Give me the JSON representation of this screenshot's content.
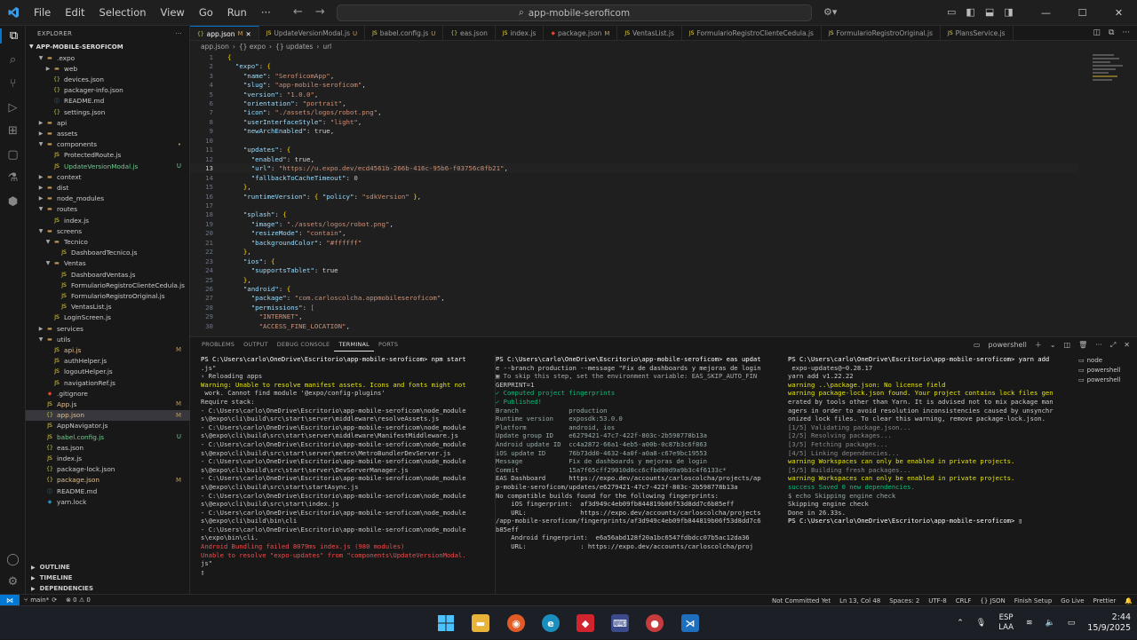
{
  "window": {
    "menu": [
      "File",
      "Edit",
      "Selection",
      "View",
      "Go",
      "Run",
      "···"
    ],
    "search": "app-mobile-seroficom"
  },
  "sidebar": {
    "header": "EXPLORER",
    "project": "APP-MOBILE-SEROFICOM",
    "tree": [
      {
        "label": ".expo",
        "depth": 1,
        "type": "folder-open",
        "badge": ""
      },
      {
        "label": "web",
        "depth": 2,
        "type": "folder",
        "badge": ""
      },
      {
        "label": "devices.json",
        "depth": 2,
        "type": "file",
        "badge": ""
      },
      {
        "label": "packager-info.json",
        "depth": 2,
        "type": "file",
        "badge": ""
      },
      {
        "label": "README.md",
        "depth": 2,
        "type": "file",
        "badge": ""
      },
      {
        "label": "settings.json",
        "depth": 2,
        "type": "file",
        "badge": ""
      },
      {
        "label": "api",
        "depth": 1,
        "type": "folder",
        "badge": ""
      },
      {
        "label": "assets",
        "depth": 1,
        "type": "folder",
        "badge": ""
      },
      {
        "label": "components",
        "depth": 1,
        "type": "folder-open",
        "badge": "•"
      },
      {
        "label": "ProtectedRoute.js",
        "depth": 2,
        "type": "file",
        "badge": ""
      },
      {
        "label": "UpdateVersionModal.js",
        "depth": 2,
        "type": "file",
        "badge": "U"
      },
      {
        "label": "context",
        "depth": 1,
        "type": "folder",
        "badge": ""
      },
      {
        "label": "dist",
        "depth": 1,
        "type": "folder",
        "badge": ""
      },
      {
        "label": "node_modules",
        "depth": 1,
        "type": "folder",
        "badge": ""
      },
      {
        "label": "routes",
        "depth": 1,
        "type": "folder-open",
        "badge": ""
      },
      {
        "label": "index.js",
        "depth": 2,
        "type": "file",
        "badge": ""
      },
      {
        "label": "screens",
        "depth": 1,
        "type": "folder-open",
        "badge": ""
      },
      {
        "label": "Tecnico",
        "depth": 2,
        "type": "folder-open",
        "badge": ""
      },
      {
        "label": "DashboardTecnico.js",
        "depth": 3,
        "type": "file",
        "badge": ""
      },
      {
        "label": "Ventas",
        "depth": 2,
        "type": "folder-open",
        "badge": ""
      },
      {
        "label": "DashboardVentas.js",
        "depth": 3,
        "type": "file",
        "badge": ""
      },
      {
        "label": "FormularioRegistroClienteCedula.js",
        "depth": 3,
        "type": "file",
        "badge": ""
      },
      {
        "label": "FormularioRegistroOriginal.js",
        "depth": 3,
        "type": "file",
        "badge": ""
      },
      {
        "label": "VentasList.js",
        "depth": 3,
        "type": "file",
        "badge": ""
      },
      {
        "label": "LoginScreen.js",
        "depth": 2,
        "type": "file",
        "badge": ""
      },
      {
        "label": "services",
        "depth": 1,
        "type": "folder",
        "badge": ""
      },
      {
        "label": "utils",
        "depth": 1,
        "type": "folder-open",
        "badge": ""
      },
      {
        "label": "api.js",
        "depth": 2,
        "type": "file",
        "badge": "M"
      },
      {
        "label": "authHelper.js",
        "depth": 2,
        "type": "file",
        "badge": ""
      },
      {
        "label": "logoutHelper.js",
        "depth": 2,
        "type": "file",
        "badge": ""
      },
      {
        "label": "navigationRef.js",
        "depth": 2,
        "type": "file",
        "badge": ""
      },
      {
        "label": ".gitignore",
        "depth": 1,
        "type": "file",
        "badge": ""
      },
      {
        "label": "App.js",
        "depth": 1,
        "type": "file",
        "badge": "M"
      },
      {
        "label": "app.json",
        "depth": 1,
        "type": "file",
        "badge": "M",
        "selected": true
      },
      {
        "label": "AppNavigator.js",
        "depth": 1,
        "type": "file",
        "badge": ""
      },
      {
        "label": "babel.config.js",
        "depth": 1,
        "type": "file",
        "badge": "U"
      },
      {
        "label": "eas.json",
        "depth": 1,
        "type": "file",
        "badge": ""
      },
      {
        "label": "index.js",
        "depth": 1,
        "type": "file",
        "badge": ""
      },
      {
        "label": "package-lock.json",
        "depth": 1,
        "type": "file",
        "badge": ""
      },
      {
        "label": "package.json",
        "depth": 1,
        "type": "file",
        "badge": "M"
      },
      {
        "label": "README.md",
        "depth": 1,
        "type": "file",
        "badge": ""
      },
      {
        "label": "yarn.lock",
        "depth": 1,
        "type": "file",
        "badge": ""
      }
    ],
    "bottom": [
      "OUTLINE",
      "TIMELINE",
      "DEPENDENCIES"
    ]
  },
  "editor": {
    "tabs": [
      {
        "label": "app.json",
        "mod": "M",
        "active": true
      },
      {
        "label": "UpdateVersionModal.js",
        "mod": "U"
      },
      {
        "label": "babel.config.js",
        "mod": "U"
      },
      {
        "label": "eas.json",
        "mod": ""
      },
      {
        "label": "index.js",
        "mod": ""
      },
      {
        "label": "package.json",
        "mod": "M"
      },
      {
        "label": "VentasList.js",
        "mod": ""
      },
      {
        "label": "FormularioRegistroClienteCedula.js",
        "mod": ""
      },
      {
        "label": "FormularioRegistroOriginal.js",
        "mod": ""
      },
      {
        "label": "PlansService.js",
        "mod": ""
      }
    ],
    "breadcrumb": [
      "app.json",
      "{} expo",
      "{} updates",
      "url"
    ],
    "lines": [
      {
        "n": "1",
        "t": "{"
      },
      {
        "n": "2",
        "t": "  \"expo\": {"
      },
      {
        "n": "3",
        "t": "    \"name\": \"SeroficomApp\","
      },
      {
        "n": "4",
        "t": "    \"slug\": \"app-mobile-seroficom\","
      },
      {
        "n": "5",
        "t": "    \"version\": \"1.0.0\","
      },
      {
        "n": "6",
        "t": "    \"orientation\": \"portrait\","
      },
      {
        "n": "7",
        "t": "    \"icon\": \"./assets/logos/robot.png\","
      },
      {
        "n": "8",
        "t": "    \"userInterfaceStyle\": \"light\","
      },
      {
        "n": "9",
        "t": "    \"newArchEnabled\": true,"
      },
      {
        "n": "10",
        "t": ""
      },
      {
        "n": "11",
        "t": "    \"updates\": {"
      },
      {
        "n": "12",
        "t": "      \"enabled\": true,"
      },
      {
        "n": "13",
        "t": "      \"url\": \"https://u.expo.dev/ecd4561b-266b-416c-95b6-f03756c8fb21\","
      },
      {
        "n": "14",
        "t": "      \"fallbackToCacheTimeout\": 0"
      },
      {
        "n": "15",
        "t": "    },"
      },
      {
        "n": "16",
        "t": "    \"runtimeVersion\": { \"policy\": \"sdkVersion\" },"
      },
      {
        "n": "17",
        "t": ""
      },
      {
        "n": "18",
        "t": "    \"splash\": {"
      },
      {
        "n": "19",
        "t": "      \"image\": \"./assets/logos/robot.png\","
      },
      {
        "n": "20",
        "t": "      \"resizeMode\": \"contain\","
      },
      {
        "n": "21",
        "t": "      \"backgroundColor\": \"#ffffff\""
      },
      {
        "n": "22",
        "t": "    },"
      },
      {
        "n": "23",
        "t": "    \"ios\": {"
      },
      {
        "n": "24",
        "t": "      \"supportsTablet\": true"
      },
      {
        "n": "25",
        "t": "    },"
      },
      {
        "n": "26",
        "t": "    \"android\": {"
      },
      {
        "n": "27",
        "t": "      \"package\": \"com.carloscolcha.appmobileseroficom\","
      },
      {
        "n": "28",
        "t": "      \"permissions\": ["
      },
      {
        "n": "29",
        "t": "        \"INTERNET\","
      },
      {
        "n": "30",
        "t": "        \"ACCESS_FINE_LOCATION\","
      }
    ]
  },
  "panel": {
    "tabs": [
      "PROBLEMS",
      "OUTPUT",
      "DEBUG CONSOLE",
      "TERMINAL",
      "PORTS"
    ],
    "active_tab": "TERMINAL",
    "shell_label": "powershell",
    "term_list": [
      "node",
      "powershell",
      "powershell"
    ],
    "term1": [
      "PS C:\\Users\\carlo\\OneDrive\\Escritorio\\app-mobile-seroficom> npm start",
      ".js\"",
      "› Reloading apps",
      "Warning: Unable to resolve manifest assets. Icons and fonts might not",
      " work. Cannot find module '@expo/config-plugins'",
      "Require stack:",
      "- C:\\Users\\carlo\\OneDrive\\Escritorio\\app-mobile-seroficom\\node_module",
      "s\\@expo\\cli\\build\\src\\start\\server\\middleware\\resolveAssets.js",
      "- C:\\Users\\carlo\\OneDrive\\Escritorio\\app-mobile-seroficom\\node_module",
      "s\\@expo\\cli\\build\\src\\start\\server\\middleware\\ManifestMiddleware.js",
      "- C:\\Users\\carlo\\OneDrive\\Escritorio\\app-mobile-seroficom\\node_module",
      "s\\@expo\\cli\\build\\src\\start\\server\\metro\\MetroBundlerDevServer.js",
      "- C:\\Users\\carlo\\OneDrive\\Escritorio\\app-mobile-seroficom\\node_module",
      "s\\@expo\\cli\\build\\src\\start\\server\\DevServerManager.js",
      "- C:\\Users\\carlo\\OneDrive\\Escritorio\\app-mobile-seroficom\\node_module",
      "s\\@expo\\cli\\build\\src\\start\\startAsync.js",
      "- C:\\Users\\carlo\\OneDrive\\Escritorio\\app-mobile-seroficom\\node_module",
      "s\\@expo\\cli\\build\\src\\start\\index.js",
      "- C:\\Users\\carlo\\OneDrive\\Escritorio\\app-mobile-seroficom\\node_module",
      "s\\@expo\\cli\\build\\bin\\cli",
      "- C:\\Users\\carlo\\OneDrive\\Escritorio\\app-mobile-seroficom\\node_module",
      "s\\expo\\bin\\cli.",
      "Android Bundling failed 8079ms index.js (980 modules)",
      "Unable to resolve \"expo-updates\" from \"components\\UpdateVersionModal.",
      "js\"",
      "▯"
    ],
    "term2": [
      "PS C:\\Users\\carlo\\OneDrive\\Escritorio\\app-mobile-seroficom> eas updat",
      "e --branch production --message \"Fix de dashboards y mejoras de login",
      "",
      "▣ To skip this step, set the environment variable: EAS_SKIP_AUTO_FIN",
      "GERPRINT=1",
      "✓ Computed project fingerprints",
      "✓ Published!",
      "",
      "Branch             production",
      "Runtime version    exposdk:53.0.0",
      "Platform           android, ios",
      "Update group ID    e6279421-47c7-422f-803c-2b598778b13a",
      "Android update ID  cc4a2872-66a1-4eb5-a00b-0c87b3c6f863",
      "iOS update ID      76b73dd0-4632-4a0f-a0a8-c67e9bc19553",
      "Message            Fix de dashboards y mejoras de login",
      "Commit             15a7f65cff29010d0cc6cfbd00d9a9b3c4f6133c*",
      "EAS Dashboard      https://expo.dev/accounts/carloscolcha/projects/ap",
      "p-mobile-seroficom/updates/e6279421-47c7-422f-803c-2b598778b13a",
      "",
      "No compatible builds found for the following fingerprints:",
      "    iOS fingerprint:  af3d949c4eb09fb844819b06f53d8dd7c6b85eff",
      "    URL:              https://expo.dev/accounts/carloscolcha/projects",
      "/app-mobile-seroficom/fingerprints/af3d949c4eb09fb844819b06f53d8dd7c6",
      "b85eff",
      "",
      "    Android fingerprint:  e6a56abd128f20a1bc6547fdbdcc07b5ac12da36",
      "    URL:              : https://expo.dev/accounts/carloscolcha/proj"
    ],
    "term3": [
      "PS C:\\Users\\carlo\\OneDrive\\Escritorio\\app-mobile-seroficom> yarn add",
      " expo-updates@~0.28.17",
      "yarn add v1.22.22",
      "warning ..\\package.json: No license field",
      "warning package-lock.json found. Your project contains lock files gen",
      "erated by tools other than Yarn. It is advised not to mix package man",
      "agers in order to avoid resolution inconsistencies caused by unsynchr",
      "onized lock files. To clear this warning, remove package-lock.json.",
      "[1/5] Validating package.json...",
      "[2/5] Resolving packages...",
      "[3/5] Fetching packages...",
      "[4/5] Linking dependencies...",
      "warning Workspaces can only be enabled in private projects.",
      "[5/5] Building fresh packages...",
      "",
      "warning Workspaces can only be enabled in private projects.",
      "success Saved 0 new dependencies.",
      "$ echo Skipping engine check",
      "Skipping engine check",
      "Done in 26.33s.",
      "PS C:\\Users\\carlo\\OneDrive\\Escritorio\\app-mobile-seroficom> ▯"
    ]
  },
  "statusbar": {
    "branch": "main*",
    "problems": "⊗ 0 ⚠ 0",
    "right": [
      "Not Committed Yet",
      "Ln 13, Col 48",
      "Spaces: 2",
      "UTF-8",
      "CRLF",
      "{} JSON",
      "Finish Setup",
      "Go Live",
      "Prettier"
    ]
  },
  "taskbar": {
    "lang1": "ESP",
    "lang2": "LAA",
    "time": "2:44",
    "date": "15/9/2025"
  }
}
